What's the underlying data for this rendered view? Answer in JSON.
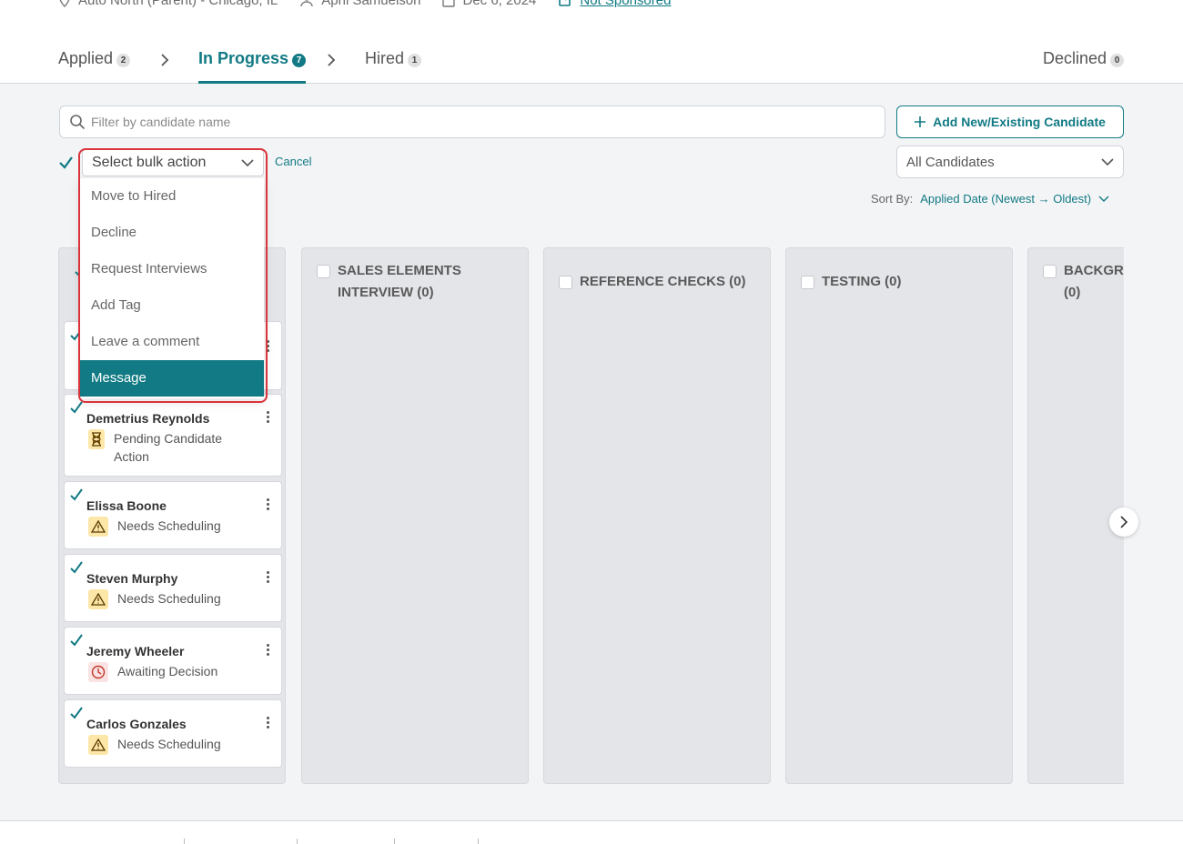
{
  "header": {
    "location": "Auto North (Parent) - Chicago, IL",
    "recruiter": "April Samuelson",
    "date": "Dec 6, 2024",
    "sponsorship": "Not Sponsored"
  },
  "tabs": [
    {
      "label": "Applied",
      "count": "2"
    },
    {
      "label": "In Progress",
      "count": "7"
    },
    {
      "label": "Hired",
      "count": "1"
    },
    {
      "label": "Declined",
      "count": "0"
    }
  ],
  "search": {
    "placeholder": "Filter by candidate name"
  },
  "add_button": "Add New/Existing Candidate",
  "bulk": {
    "placeholder": "Select bulk action",
    "cancel": "Cancel",
    "options": [
      "Move to Hired",
      "Decline",
      "Request Interviews",
      "Add Tag",
      "Leave a comment",
      "Message"
    ],
    "highlighted": "Message"
  },
  "filter": {
    "value": "All Candidates"
  },
  "sort": {
    "label": "Sort By:",
    "value": "Applied Date (Newest → Oldest)"
  },
  "columns": [
    {
      "title": ""
    },
    {
      "title": "SALES ELEMENTS INTERVIEW (0)"
    },
    {
      "title": "REFERENCE CHECKS (0)"
    },
    {
      "title": "TESTING (0)"
    },
    {
      "title": "BACKGR (0)"
    }
  ],
  "cards": [
    {
      "name": "Demetrius Reynolds",
      "status": "Pending Candidate Action",
      "status_type": "hourglass-icon"
    },
    {
      "name": "Elissa Boone",
      "status": "Needs Scheduling",
      "status_type": "warning-icon"
    },
    {
      "name": "Steven Murphy",
      "status": "Needs Scheduling",
      "status_type": "warning-icon"
    },
    {
      "name": "Jeremy Wheeler",
      "status": "Awaiting Decision",
      "status_type": "clock-icon"
    },
    {
      "name": "Carlos Gonzales",
      "status": "Needs Scheduling",
      "status_type": "warning-icon"
    }
  ],
  "colors": {
    "accent": "#117a84",
    "highlight_border": "#d9343a",
    "column_bg": "#e4e5e9"
  }
}
